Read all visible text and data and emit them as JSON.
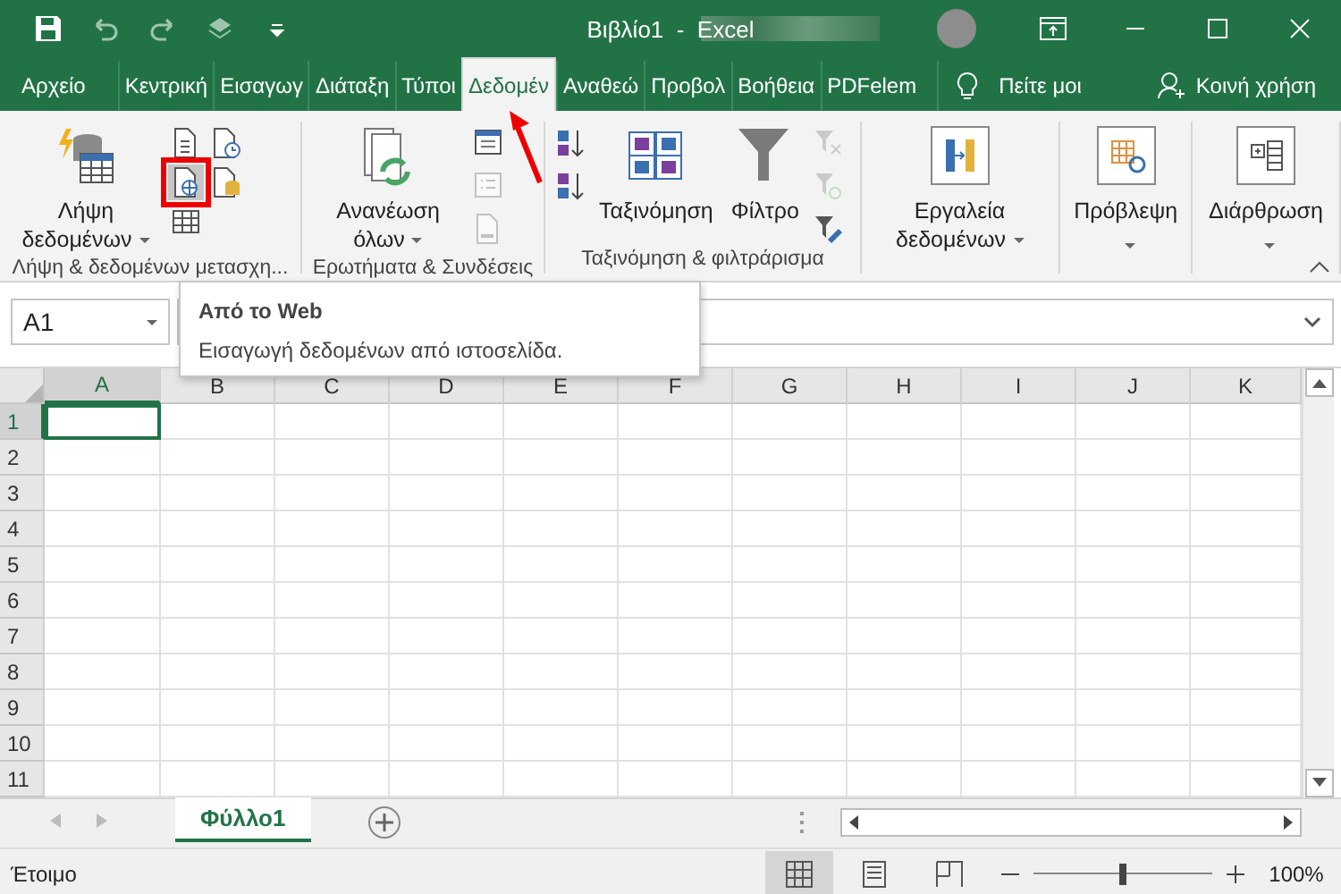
{
  "window": {
    "title": "Βιβλίο1  -  Excel"
  },
  "ribbon_tabs": [
    {
      "label": "Αρχείο",
      "selected": false
    },
    {
      "label": "Κεντρική",
      "selected": false
    },
    {
      "label": "Εισαγωγ",
      "selected": false
    },
    {
      "label": "Διάταξη",
      "selected": false
    },
    {
      "label": "Τύποι",
      "selected": false
    },
    {
      "label": "Δεδομέν",
      "selected": true
    },
    {
      "label": "Αναθεώ",
      "selected": false
    },
    {
      "label": "Προβολ",
      "selected": false
    },
    {
      "label": "Βοήθεια",
      "selected": false
    },
    {
      "label": "PDFelem",
      "selected": false
    }
  ],
  "tell_me": "Πείτε μοι",
  "share": "Κοινή χρήση",
  "ribbon_groups": [
    {
      "label": "Λήψη & δεδομένων μετασχη...",
      "commands": [
        {
          "kind": "large",
          "label": "Λήψη δεδομένων",
          "dropdown": true
        },
        {
          "kind": "small",
          "disabled": false,
          "selected": false
        },
        {
          "kind": "small",
          "disabled": false,
          "selected": false
        },
        {
          "kind": "small",
          "disabled": false,
          "selected": true
        },
        {
          "kind": "small",
          "disabled": false,
          "selected": false
        },
        {
          "kind": "small",
          "disabled": false,
          "selected": false
        }
      ]
    },
    {
      "label": "Ερωτήματα & Συνδέσεις",
      "commands": [
        {
          "kind": "large",
          "label": "Ανανέωση όλων",
          "dropdown": true
        },
        {
          "kind": "small",
          "disabled": false,
          "selected": false
        },
        {
          "kind": "small",
          "disabled": true,
          "selected": false
        },
        {
          "kind": "small",
          "disabled": true,
          "selected": false
        }
      ]
    },
    {
      "label": "Ταξινόμηση & φιλτράρισμα",
      "commands": [
        {
          "kind": "small",
          "disabled": false,
          "selected": false
        },
        {
          "kind": "small",
          "disabled": false,
          "selected": false
        },
        {
          "kind": "large",
          "label": "Ταξινόμηση",
          "dropdown": false
        },
        {
          "kind": "large",
          "label": "Φίλτρο",
          "dropdown": false
        },
        {
          "kind": "small",
          "disabled": true,
          "selected": false
        },
        {
          "kind": "small",
          "disabled": true,
          "selected": false
        },
        {
          "kind": "small",
          "disabled": false,
          "selected": false
        }
      ]
    },
    {
      "commands": [
        {
          "kind": "large",
          "label": "Εργαλεία δεδομένων",
          "dropdown": true
        }
      ]
    },
    {
      "commands": [
        {
          "kind": "large",
          "label": "Πρόβλεψη",
          "dropdown": true
        }
      ]
    },
    {
      "commands": [
        {
          "kind": "large",
          "label": "Διάρθρωση",
          "dropdown": true
        }
      ]
    }
  ],
  "tooltip": {
    "title": "Από το Web",
    "text": "Εισαγωγή δεδομένων από ιστοσελίδα."
  },
  "name_box": "A1",
  "columns": [
    {
      "label": "A",
      "selected": true
    },
    {
      "label": "B",
      "selected": false
    },
    {
      "label": "C",
      "selected": false
    },
    {
      "label": "D",
      "selected": false
    },
    {
      "label": "E",
      "selected": false
    },
    {
      "label": "F",
      "selected": false
    },
    {
      "label": "G",
      "selected": false
    },
    {
      "label": "H",
      "selected": false
    },
    {
      "label": "I",
      "selected": false
    },
    {
      "label": "J",
      "selected": false
    },
    {
      "label": "K",
      "selected": false
    }
  ],
  "rows": [
    {
      "label": "1",
      "selected": true
    },
    {
      "label": "2",
      "selected": false
    },
    {
      "label": "3",
      "selected": false
    },
    {
      "label": "4",
      "selected": false
    },
    {
      "label": "5",
      "selected": false
    },
    {
      "label": "6",
      "selected": false
    },
    {
      "label": "7",
      "selected": false
    },
    {
      "label": "8",
      "selected": false
    },
    {
      "label": "9",
      "selected": false
    },
    {
      "label": "10",
      "selected": false
    },
    {
      "label": "11",
      "selected": false
    }
  ],
  "sheet_tabs": [
    {
      "label": "Φύλλο1",
      "selected": true
    }
  ],
  "status_bar": {
    "status": "Έτοιμο",
    "zoom": "100%",
    "zoom_level": {
      "level": 0.5
    }
  }
}
